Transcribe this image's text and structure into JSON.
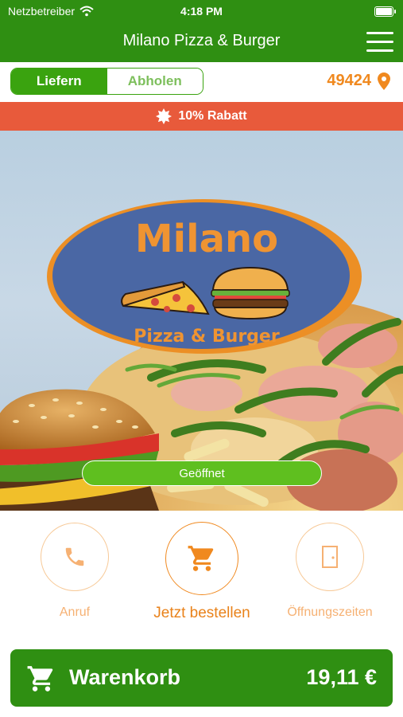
{
  "status": {
    "carrier": "Netzbetreiber",
    "time": "4:18 PM",
    "battery_level": 1.0
  },
  "header": {
    "title": "Milano Pizza & Burger"
  },
  "mode": {
    "deliver": "Liefern",
    "pickup": "Abholen",
    "selected": "deliver"
  },
  "location": {
    "zip": "49424"
  },
  "promo": {
    "text": "10% Rabatt"
  },
  "logo": {
    "name": "Milano",
    "subtitle": "Pizza & Burger"
  },
  "hero": {
    "status": "Geöffnet"
  },
  "actions": {
    "call": "Anruf",
    "order": "Jetzt bestellen",
    "hours": "Öffnungszeiten"
  },
  "cart": {
    "label": "Warenkorb",
    "total": "19,11 €"
  },
  "colors": {
    "primary": "#2f8f12",
    "accent": "#f0891f",
    "promo": "#e85a3b",
    "open": "#5fbf1f"
  }
}
